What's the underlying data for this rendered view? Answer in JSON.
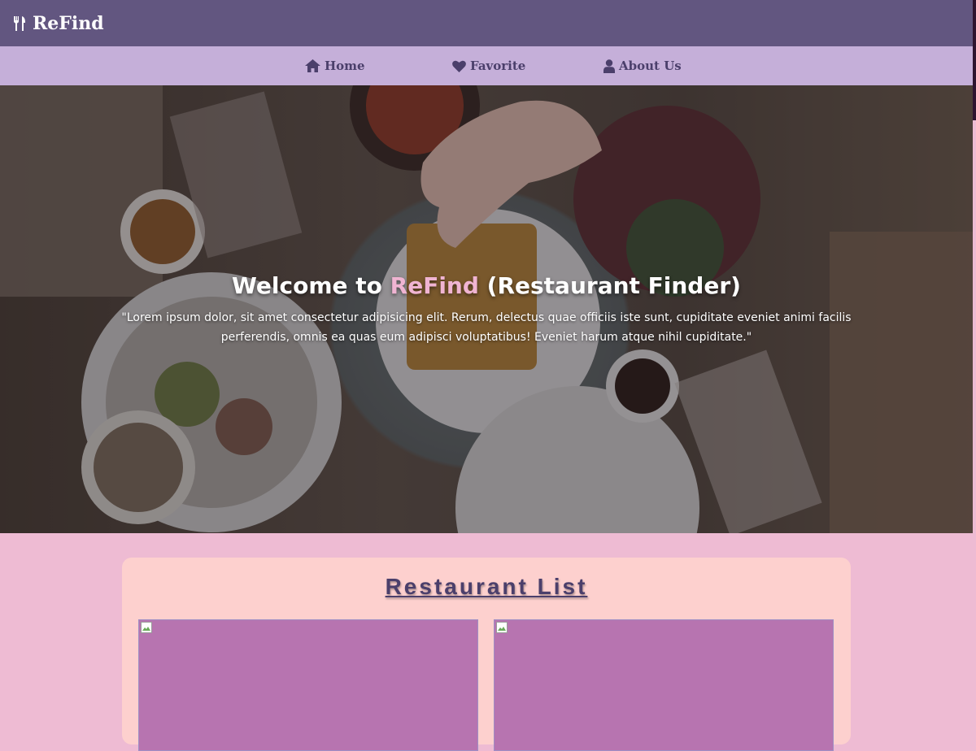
{
  "brand": {
    "name": "ReFind",
    "icon": "utensils-icon"
  },
  "nav": {
    "items": [
      {
        "label": "Home",
        "icon": "home-icon"
      },
      {
        "label": "Favorite",
        "icon": "heart-icon"
      },
      {
        "label": "About Us",
        "icon": "user-icon"
      }
    ]
  },
  "hero": {
    "title_prefix": "Welcome to ",
    "title_accent": "ReFind",
    "title_suffix": " (Restaurant Finder)",
    "subtitle": "\"Lorem ipsum dolor, sit amet consectetur adipisicing elit. Rerum, delectus quae officiis iste sunt, cupiditate eveniet animi facilis perferendis, omnis ea quas eum adipisci voluptatibus! Eveniet harum atque nihil cupiditate.\""
  },
  "restaurant_list": {
    "title": "Restaurant List"
  },
  "colors": {
    "header": "#625680",
    "nav": "#c5afd9",
    "accent": "#f0b4d2",
    "page": "#eebbd3",
    "card": "#fdd0ce",
    "tile": "#b774b0",
    "text_dark": "#4b3f6b"
  }
}
